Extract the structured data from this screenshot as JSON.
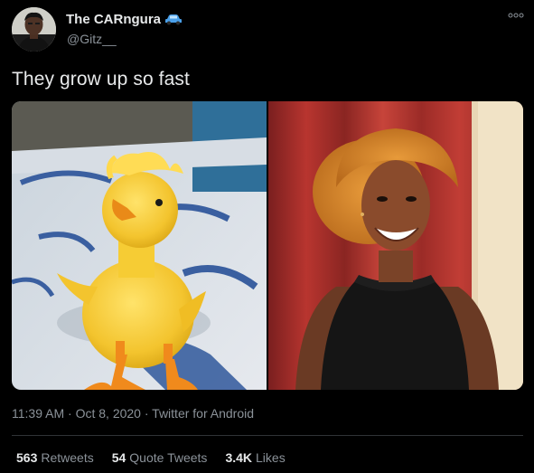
{
  "author": {
    "display_name": "The CARngura",
    "handle": "@Gitz__"
  },
  "tweet": {
    "text": "They grow up so fast",
    "time": "11:39 AM",
    "date": "Oct 8, 2020",
    "separator": "·",
    "source": "Twitter for Android"
  },
  "stats": {
    "retweets_count": "563",
    "retweets_label": "Retweets",
    "quote_count": "54",
    "quote_label": "Quote Tweets",
    "likes_count": "3.4K",
    "likes_label": "Likes"
  },
  "icons": {
    "more": "more-options-icon",
    "verified_emoji": "car-emoji-icon"
  },
  "colors": {
    "background": "#000000",
    "primary_text": "#e7e9ea",
    "secondary_text": "#8b9299",
    "divider": "#2f3336"
  }
}
